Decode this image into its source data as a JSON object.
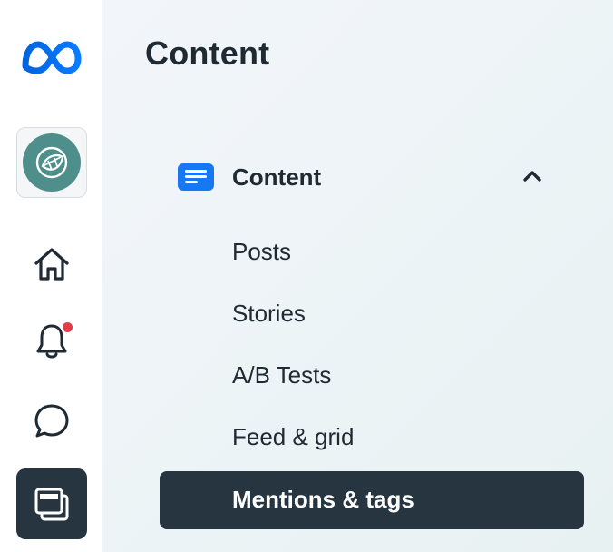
{
  "sidebar": {
    "logo_icon": "meta-logo-icon",
    "account_icon": "account-avatar",
    "items": [
      {
        "icon": "home-icon"
      },
      {
        "icon": "bell-icon",
        "has_notification": true
      },
      {
        "icon": "chat-icon"
      },
      {
        "icon": "content-icon",
        "active": true
      }
    ]
  },
  "page": {
    "title": "Content"
  },
  "section": {
    "label": "Content",
    "icon": "content-list-icon",
    "expanded": true,
    "items": [
      {
        "label": "Posts"
      },
      {
        "label": "Stories"
      },
      {
        "label": "A/B Tests"
      },
      {
        "label": "Feed & grid"
      },
      {
        "label": "Mentions & tags",
        "active": true
      }
    ]
  },
  "colors": {
    "meta_blue": "#0a7cff",
    "accent_blue": "#1877f2",
    "active_bg": "#263540",
    "text": "#1f2a33",
    "notification": "#e23c4b",
    "avatar": "#4f8f8b"
  }
}
